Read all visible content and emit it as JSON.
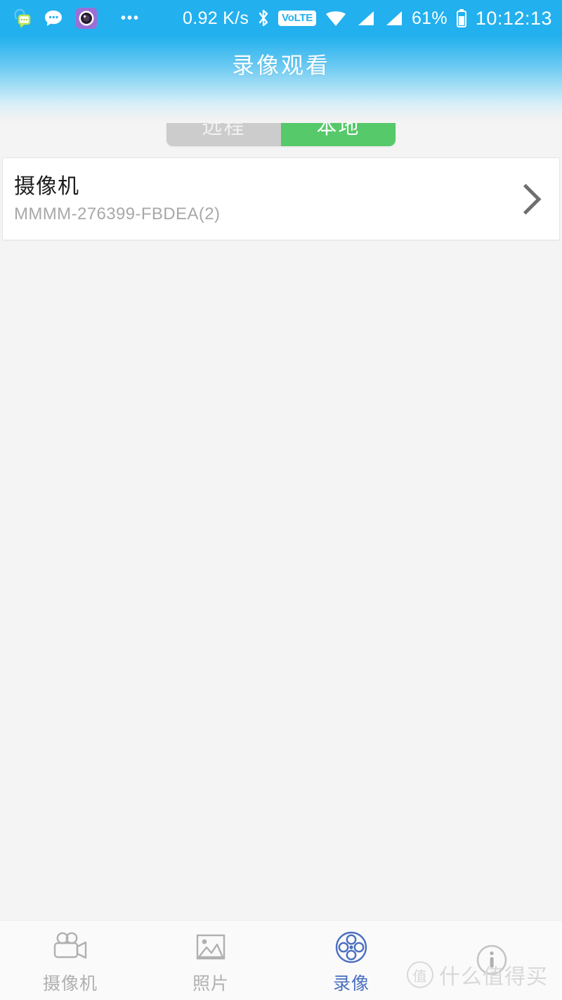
{
  "statusbar": {
    "icons_left": [
      "lock-message-icon",
      "chat-bubble-icon",
      "camera-app-icon",
      "overflow-dots-icon"
    ],
    "network_speed": "0.92 K/s",
    "bluetooth_icon": "bluetooth-icon",
    "volte_label": "VoLTE",
    "wifi_icon": "wifi-icon",
    "signal_icons": [
      "signal-bars-icon",
      "signal-bars-icon"
    ],
    "battery_percent": "61%",
    "battery_icon": "battery-icon",
    "time": "10:12:13",
    "background_color": "#23b0ee"
  },
  "header": {
    "title": "录像观看",
    "gradient_from": "#23b0ee",
    "gradient_to": "#f4f4f4"
  },
  "segment": {
    "remote_label": "远程",
    "local_label": "本地",
    "active": "local",
    "inactive_color": "#cccccc",
    "active_color": "#56c96a"
  },
  "device_list": [
    {
      "name": "摄像机",
      "id": "MMMM-276399-FBDEA(2)",
      "chevron": "chevron-right-icon"
    }
  ],
  "bottomnav": {
    "active_color": "#4a6fc0",
    "inactive_color": "#b0b0b0",
    "tabs": [
      {
        "label": "摄像机",
        "icon": "camcorder-icon",
        "active": false
      },
      {
        "label": "照片",
        "icon": "image-icon",
        "active": false
      },
      {
        "label": "录像",
        "icon": "film-reel-icon",
        "active": true
      },
      {
        "label": "",
        "icon": "info-circle-icon",
        "active": false
      }
    ]
  },
  "watermark": {
    "badge": "值",
    "text": "什么值得买"
  }
}
